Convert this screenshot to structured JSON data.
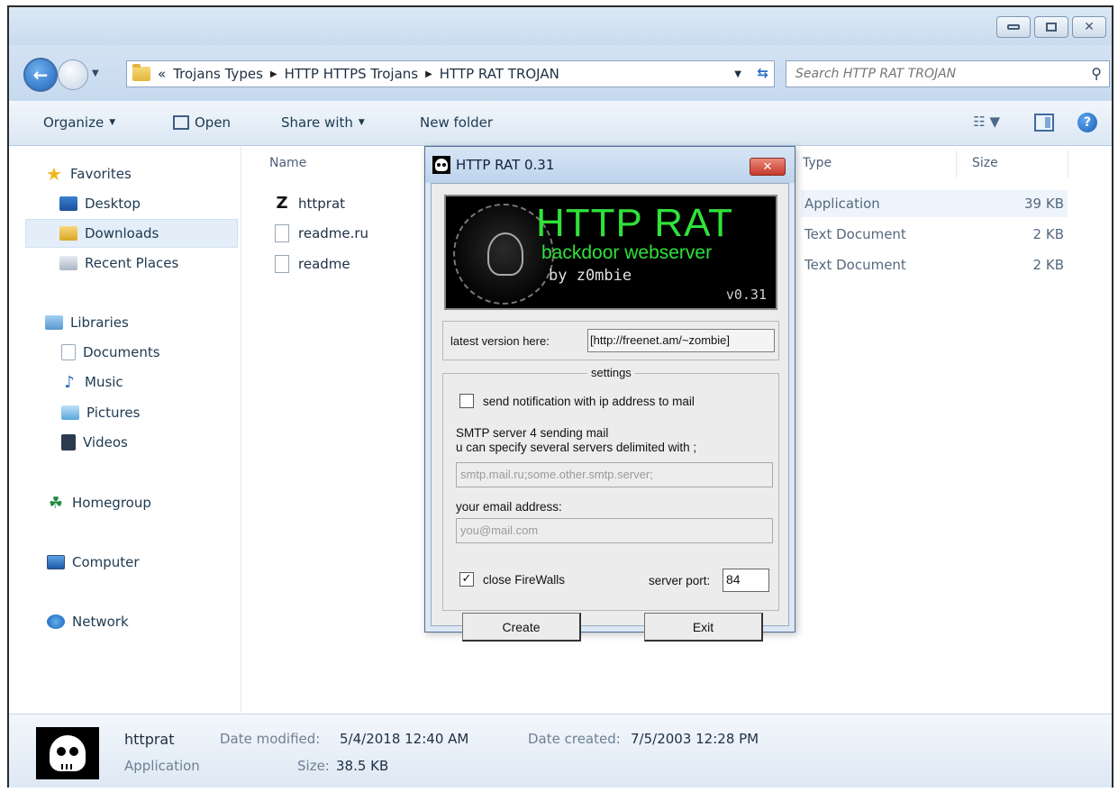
{
  "explorer": {
    "breadcrumb": {
      "overflow": "«",
      "parts": [
        "Trojans Types",
        "HTTP HTTPS Trojans",
        "HTTP RAT TROJAN"
      ]
    },
    "search": {
      "placeholder": "Search HTTP RAT TROJAN"
    },
    "toolbar": {
      "organize": "Organize",
      "open": "Open",
      "share_with": "Share with",
      "new_folder": "New folder"
    },
    "nav": {
      "favorites": "Favorites",
      "desktop": "Desktop",
      "downloads": "Downloads",
      "recent_places": "Recent Places",
      "libraries": "Libraries",
      "documents": "Documents",
      "music": "Music",
      "pictures": "Pictures",
      "videos": "Videos",
      "homegroup": "Homegroup",
      "computer": "Computer",
      "network": "Network"
    },
    "columns": {
      "name": "Name",
      "type": "Type",
      "size": "Size"
    },
    "files": [
      {
        "name": "httprat",
        "type": "Application",
        "size": "39 KB"
      },
      {
        "name": "readme.ru",
        "type": "Text Document",
        "size": "2 KB"
      },
      {
        "name": "readme",
        "type": "Text Document",
        "size": "2 KB"
      }
    ],
    "details": {
      "name": "httprat",
      "type": "Application",
      "date_modified_label": "Date modified:",
      "date_modified": "5/4/2018 12:40 AM",
      "date_created_label": "Date created:",
      "date_created": "7/5/2003 12:28 PM",
      "size_label": "Size:",
      "size": "38.5 KB"
    }
  },
  "dialog": {
    "title": "HTTP RAT 0.31",
    "close_glyph": "✕",
    "banner": {
      "title": "HTTP RAT",
      "subtitle": "backdoor webserver",
      "author": "by z0mbie",
      "version": "v0.31"
    },
    "latest_label": "latest version here:",
    "latest_url": "[http://freenet.am/~zombie]",
    "settings_legend": "settings",
    "send_notification_label": "send notification with ip address to mail",
    "send_notification_checked": false,
    "smtp_label_line1": "SMTP server 4 sending mail",
    "smtp_label_line2": "u can specify several servers delimited with ;",
    "smtp_placeholder": "smtp.mail.ru;some.other.smtp.server;",
    "email_label": "your email address:",
    "email_placeholder": "you@mail.com",
    "close_firewalls_label": "close FireWalls",
    "close_firewalls_checked": true,
    "server_port_label": "server port:",
    "server_port": "84",
    "create_label": "Create",
    "exit_label": "Exit"
  }
}
